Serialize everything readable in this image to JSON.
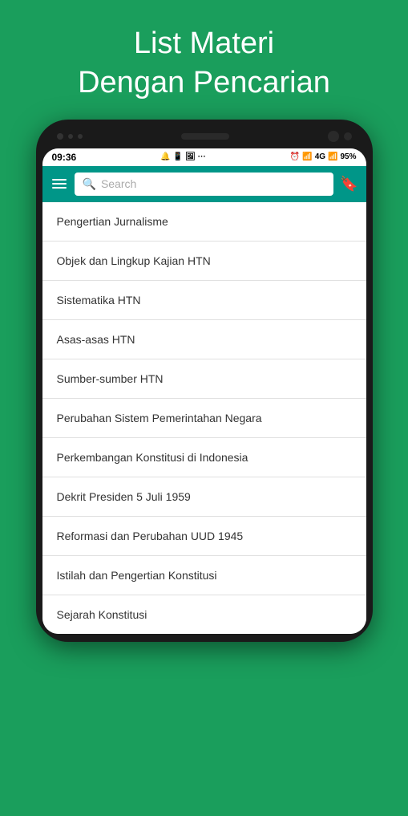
{
  "page": {
    "title_line1": "List Materi",
    "title_line2": "Dengan Pencarian",
    "background_color": "#1a9e5c"
  },
  "status_bar": {
    "time": "09:36",
    "battery_percent": "95%",
    "network": "4G"
  },
  "toolbar": {
    "search_placeholder": "Search",
    "search_label": "Search"
  },
  "list_items": [
    {
      "id": 1,
      "label": "Pengertian Jurnalisme"
    },
    {
      "id": 2,
      "label": "Objek dan Lingkup Kajian HTN"
    },
    {
      "id": 3,
      "label": "Sistematika HTN"
    },
    {
      "id": 4,
      "label": "Asas-asas HTN"
    },
    {
      "id": 5,
      "label": "Sumber-sumber HTN"
    },
    {
      "id": 6,
      "label": "Perubahan Sistem Pemerintahan Negara"
    },
    {
      "id": 7,
      "label": "Perkembangan Konstitusi di Indonesia"
    },
    {
      "id": 8,
      "label": "Dekrit Presiden 5 Juli 1959"
    },
    {
      "id": 9,
      "label": "Reformasi dan Perubahan UUD 1945"
    },
    {
      "id": 10,
      "label": "Istilah dan Pengertian Konstitusi"
    },
    {
      "id": 11,
      "label": "Sejarah Konstitusi"
    }
  ],
  "icons": {
    "menu": "☰",
    "search": "🔍",
    "bookmark": "🔖"
  }
}
